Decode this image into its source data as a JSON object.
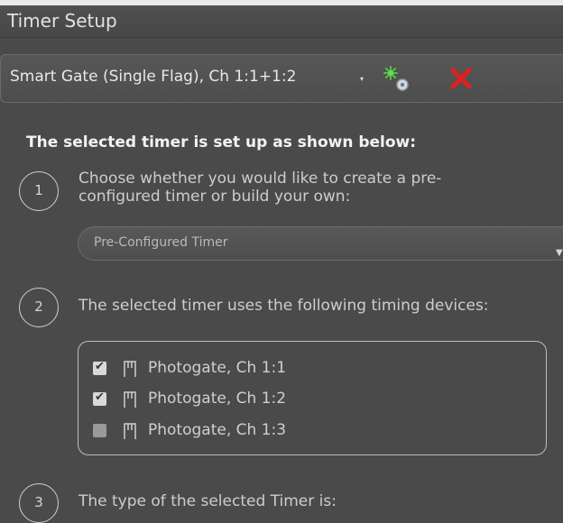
{
  "window": {
    "title": "Timer Setup"
  },
  "timer_selector": {
    "name": "Smart Gate (Single Flag), Ch 1:1+1:2",
    "caret": "▾",
    "add_icon": "sensors-gear-icon",
    "remove_icon": "red-x-icon",
    "accent_remove": "#e21f1f",
    "accent_add": "#4cc43c"
  },
  "main": {
    "heading": "The selected timer is set up as shown below:",
    "steps": [
      {
        "number": "1",
        "text_line1": "Choose whether you would like to create a pre-",
        "text_line2": "configured timer or build your own:"
      },
      {
        "number": "2",
        "text": "The selected timer uses the following timing devices:"
      },
      {
        "number": "3",
        "text": "The type of the selected Timer is:"
      }
    ],
    "config_select": {
      "value": "Pre-Configured Timer",
      "caret": "▼"
    },
    "devices": [
      {
        "label": "Photogate, Ch 1:1",
        "checked": true
      },
      {
        "label": "Photogate, Ch 1:2",
        "checked": true
      },
      {
        "label": "Photogate, Ch 1:3",
        "checked": false
      }
    ],
    "check_glyph": "✔"
  }
}
